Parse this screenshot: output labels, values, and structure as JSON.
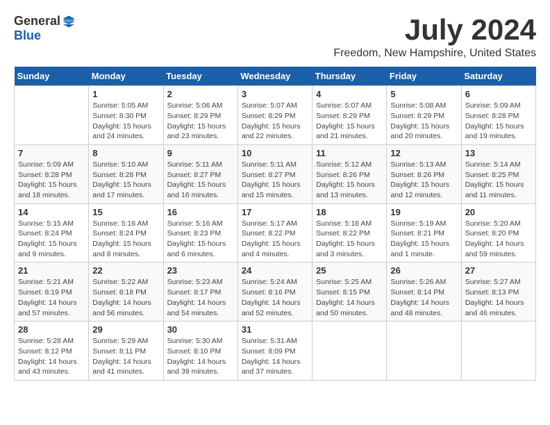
{
  "header": {
    "logo_general": "General",
    "logo_blue": "Blue",
    "month_title": "July 2024",
    "location": "Freedom, New Hampshire, United States"
  },
  "days_of_week": [
    "Sunday",
    "Monday",
    "Tuesday",
    "Wednesday",
    "Thursday",
    "Friday",
    "Saturday"
  ],
  "weeks": [
    [
      {
        "day": "",
        "info": ""
      },
      {
        "day": "1",
        "info": "Sunrise: 5:05 AM\nSunset: 8:30 PM\nDaylight: 15 hours\nand 24 minutes."
      },
      {
        "day": "2",
        "info": "Sunrise: 5:06 AM\nSunset: 8:29 PM\nDaylight: 15 hours\nand 23 minutes."
      },
      {
        "day": "3",
        "info": "Sunrise: 5:07 AM\nSunset: 8:29 PM\nDaylight: 15 hours\nand 22 minutes."
      },
      {
        "day": "4",
        "info": "Sunrise: 5:07 AM\nSunset: 8:29 PM\nDaylight: 15 hours\nand 21 minutes."
      },
      {
        "day": "5",
        "info": "Sunrise: 5:08 AM\nSunset: 8:29 PM\nDaylight: 15 hours\nand 20 minutes."
      },
      {
        "day": "6",
        "info": "Sunrise: 5:09 AM\nSunset: 8:28 PM\nDaylight: 15 hours\nand 19 minutes."
      }
    ],
    [
      {
        "day": "7",
        "info": "Sunrise: 5:09 AM\nSunset: 8:28 PM\nDaylight: 15 hours\nand 18 minutes."
      },
      {
        "day": "8",
        "info": "Sunrise: 5:10 AM\nSunset: 8:28 PM\nDaylight: 15 hours\nand 17 minutes."
      },
      {
        "day": "9",
        "info": "Sunrise: 5:11 AM\nSunset: 8:27 PM\nDaylight: 15 hours\nand 16 minutes."
      },
      {
        "day": "10",
        "info": "Sunrise: 5:11 AM\nSunset: 8:27 PM\nDaylight: 15 hours\nand 15 minutes."
      },
      {
        "day": "11",
        "info": "Sunrise: 5:12 AM\nSunset: 8:26 PM\nDaylight: 15 hours\nand 13 minutes."
      },
      {
        "day": "12",
        "info": "Sunrise: 5:13 AM\nSunset: 8:26 PM\nDaylight: 15 hours\nand 12 minutes."
      },
      {
        "day": "13",
        "info": "Sunrise: 5:14 AM\nSunset: 8:25 PM\nDaylight: 15 hours\nand 11 minutes."
      }
    ],
    [
      {
        "day": "14",
        "info": "Sunrise: 5:15 AM\nSunset: 8:24 PM\nDaylight: 15 hours\nand 9 minutes."
      },
      {
        "day": "15",
        "info": "Sunrise: 5:16 AM\nSunset: 8:24 PM\nDaylight: 15 hours\nand 8 minutes."
      },
      {
        "day": "16",
        "info": "Sunrise: 5:16 AM\nSunset: 8:23 PM\nDaylight: 15 hours\nand 6 minutes."
      },
      {
        "day": "17",
        "info": "Sunrise: 5:17 AM\nSunset: 8:22 PM\nDaylight: 15 hours\nand 4 minutes."
      },
      {
        "day": "18",
        "info": "Sunrise: 5:18 AM\nSunset: 8:22 PM\nDaylight: 15 hours\nand 3 minutes."
      },
      {
        "day": "19",
        "info": "Sunrise: 5:19 AM\nSunset: 8:21 PM\nDaylight: 15 hours\nand 1 minute."
      },
      {
        "day": "20",
        "info": "Sunrise: 5:20 AM\nSunset: 8:20 PM\nDaylight: 14 hours\nand 59 minutes."
      }
    ],
    [
      {
        "day": "21",
        "info": "Sunrise: 5:21 AM\nSunset: 8:19 PM\nDaylight: 14 hours\nand 57 minutes."
      },
      {
        "day": "22",
        "info": "Sunrise: 5:22 AM\nSunset: 8:18 PM\nDaylight: 14 hours\nand 56 minutes."
      },
      {
        "day": "23",
        "info": "Sunrise: 5:23 AM\nSunset: 8:17 PM\nDaylight: 14 hours\nand 54 minutes."
      },
      {
        "day": "24",
        "info": "Sunrise: 5:24 AM\nSunset: 8:16 PM\nDaylight: 14 hours\nand 52 minutes."
      },
      {
        "day": "25",
        "info": "Sunrise: 5:25 AM\nSunset: 8:15 PM\nDaylight: 14 hours\nand 50 minutes."
      },
      {
        "day": "26",
        "info": "Sunrise: 5:26 AM\nSunset: 8:14 PM\nDaylight: 14 hours\nand 48 minutes."
      },
      {
        "day": "27",
        "info": "Sunrise: 5:27 AM\nSunset: 8:13 PM\nDaylight: 14 hours\nand 46 minutes."
      }
    ],
    [
      {
        "day": "28",
        "info": "Sunrise: 5:28 AM\nSunset: 8:12 PM\nDaylight: 14 hours\nand 43 minutes."
      },
      {
        "day": "29",
        "info": "Sunrise: 5:29 AM\nSunset: 8:11 PM\nDaylight: 14 hours\nand 41 minutes."
      },
      {
        "day": "30",
        "info": "Sunrise: 5:30 AM\nSunset: 8:10 PM\nDaylight: 14 hours\nand 39 minutes."
      },
      {
        "day": "31",
        "info": "Sunrise: 5:31 AM\nSunset: 8:09 PM\nDaylight: 14 hours\nand 37 minutes."
      },
      {
        "day": "",
        "info": ""
      },
      {
        "day": "",
        "info": ""
      },
      {
        "day": "",
        "info": ""
      }
    ]
  ]
}
